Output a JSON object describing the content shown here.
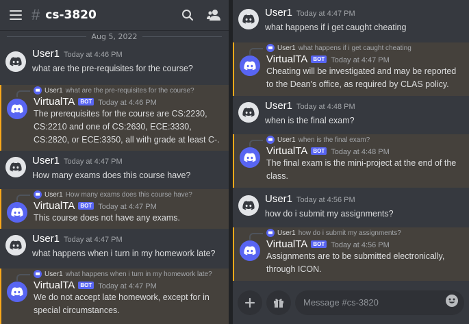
{
  "colors": {
    "accent": "#5865f2",
    "reply_highlight": "#faa81a",
    "bg": "#36393f"
  },
  "header": {
    "hash": "#",
    "channel": "cs-3820",
    "icons": [
      "menu-icon",
      "search-icon",
      "members-icon"
    ]
  },
  "date_separator": "Aug 5, 2022",
  "left_messages": [
    {
      "author": "User1",
      "time": "Today at 4:46 PM",
      "text": "what are the pre-requisites for the course?"
    },
    {
      "reply_user": "User1",
      "reply_text": "what are the pre-requisites for the course?",
      "author": "VirtualTA",
      "tag": "BOT",
      "time": "Today at 4:46 PM",
      "text": "The prerequisites for the course are CS:2230, CS:2210 and one of CS:2630, ECE:3330, CS:2820, or ECE:3350, all with grade at least C-."
    },
    {
      "author": "User1",
      "time": "Today at 4:47 PM",
      "text": "How many exams does this course have?"
    },
    {
      "reply_user": "User1",
      "reply_text": "How many exams does this course have?",
      "author": "VirtualTA",
      "tag": "BOT",
      "time": "Today at 4:47 PM",
      "text": "This course does not have any exams."
    },
    {
      "author": "User1",
      "time": "Today at 4:47 PM",
      "text": "what happens when i turn in my homework late?"
    },
    {
      "reply_user": "User1",
      "reply_text": "what happens when i turn in my homework late?",
      "author": "VirtualTA",
      "tag": "BOT",
      "time": "Today at 4:47 PM",
      "text": "We do not accept late homework, except for in special circumstances."
    }
  ],
  "right_messages": [
    {
      "author": "User1",
      "time": "Today at 4:47 PM",
      "text": "what happens if i get caught cheating"
    },
    {
      "reply_user": "User1",
      "reply_text": "what happens if i get caught cheating",
      "author": "VirtualTA",
      "tag": "BOT",
      "time": "Today at 4:47 PM",
      "text": "Cheating will be investigated and may be reported to the Dean's office, as required by CLAS policy."
    },
    {
      "author": "User1",
      "time": "Today at 4:48 PM",
      "text": "when is the final exam?"
    },
    {
      "reply_user": "User1",
      "reply_text": "when is the final exam?",
      "author": "VirtualTA",
      "tag": "BOT",
      "time": "Today at 4:48 PM",
      "text": "The final exam is the mini-project at the end of the class."
    },
    {
      "author": "User1",
      "time": "Today at 4:56 PM",
      "text": "how do i submit my assignments?"
    },
    {
      "reply_user": "User1",
      "reply_text": "how do i submit my assignments?",
      "author": "VirtualTA",
      "tag": "BOT",
      "time": "Today at 4:56 PM",
      "text": "Assignments are to be submitted electronically, through ICON."
    }
  ],
  "composer": {
    "placeholder": "Message #cs-3820",
    "icons": [
      "plus-icon",
      "gift-icon",
      "emoji-icon"
    ]
  }
}
